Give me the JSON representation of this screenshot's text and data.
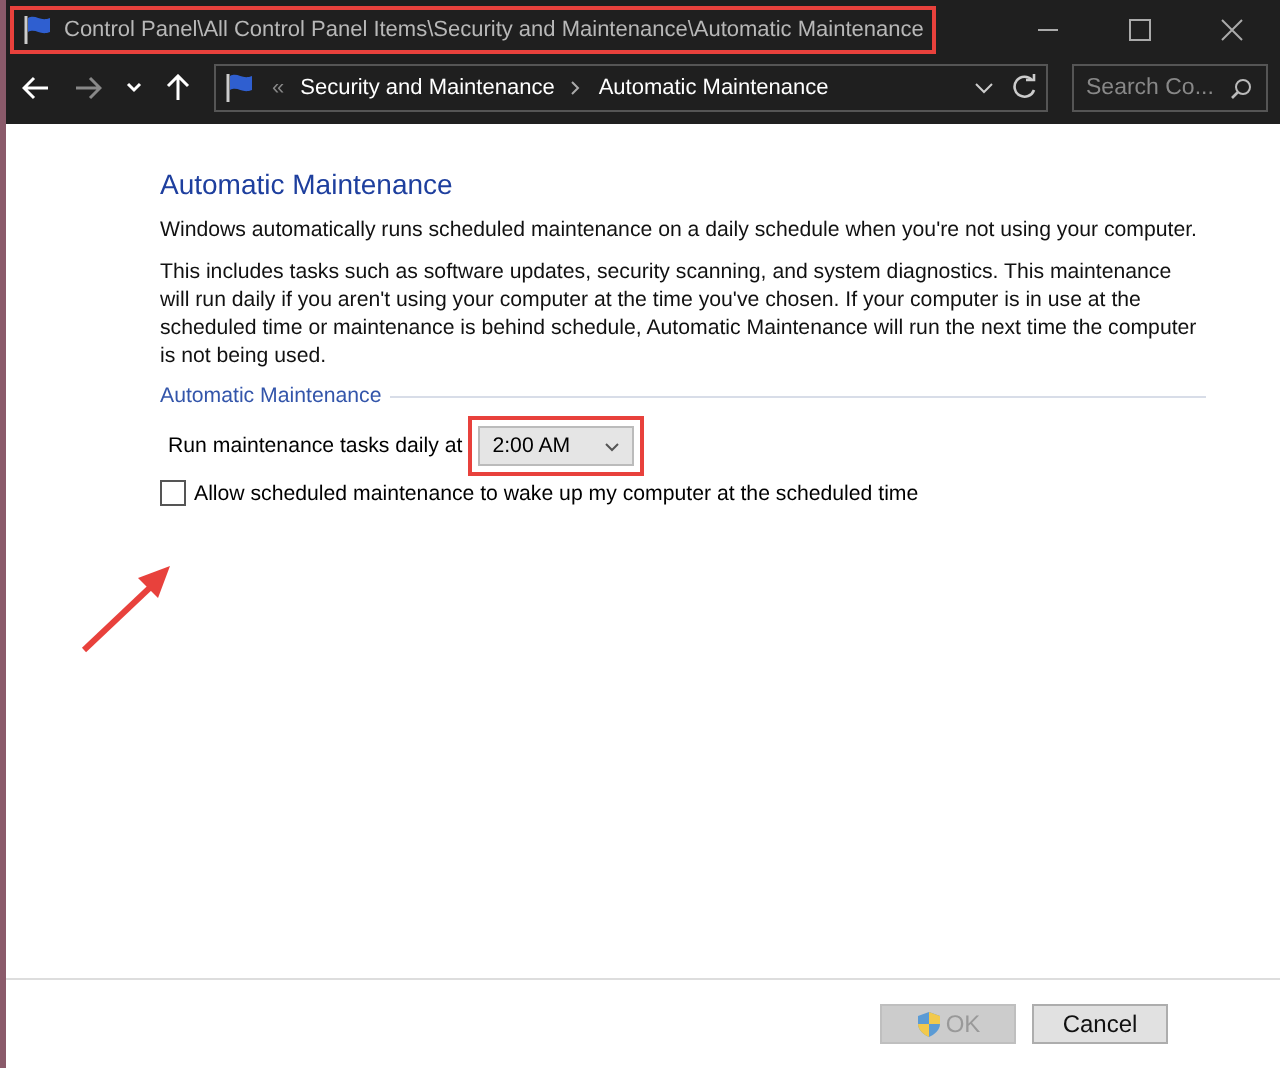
{
  "window": {
    "title": "Control Panel\\All Control Panel Items\\Security and Maintenance\\Automatic Maintenance"
  },
  "address_bar": {
    "separator": "«",
    "path": [
      "Security and Maintenance",
      "Automatic Maintenance"
    ],
    "search": {
      "placeholder": "Search Co..."
    }
  },
  "page": {
    "heading": "Automatic Maintenance",
    "paragraphs": [
      "Windows automatically runs scheduled maintenance on a daily schedule when you're not using your computer.",
      "This includes tasks such as software updates, security scanning, and system diagnostics. This maintenance will run daily if you aren't using your computer at the time you've chosen. If your computer is in use at the scheduled time or maintenance is behind schedule, Automatic Maintenance will run the next time the computer is not being used."
    ],
    "group": {
      "title": "Automatic Maintenance",
      "time_label": "Run maintenance tasks daily at",
      "time_value": "2:00 AM",
      "wake": {
        "label": "Allow scheduled maintenance to wake up my computer at the scheduled time",
        "checked": false
      }
    }
  },
  "buttons": [
    {
      "label": "OK",
      "disabled": true,
      "kind": "shield"
    },
    {
      "label": "Cancel",
      "disabled": false,
      "kind": "plain"
    }
  ]
}
